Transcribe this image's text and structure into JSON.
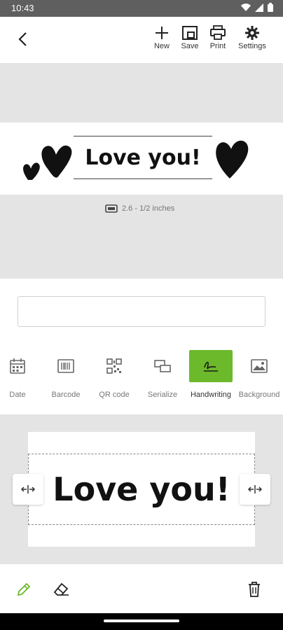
{
  "status": {
    "time": "10:43"
  },
  "toolbar": {
    "new_label": "New",
    "save_label": "Save",
    "print_label": "Print",
    "settings_label": "Settings"
  },
  "preview": {
    "label_text": "Love you!",
    "size_text": "2.6 - 1/2 inches"
  },
  "input": {
    "value": ""
  },
  "tools": [
    {
      "label": "Date",
      "icon": "calendar-icon"
    },
    {
      "label": "Barcode",
      "icon": "barcode-icon"
    },
    {
      "label": "QR code",
      "icon": "qr-code-icon"
    },
    {
      "label": "Serialize",
      "icon": "serialize-icon"
    },
    {
      "label": "Handwriting",
      "icon": "signature-icon",
      "active": true
    },
    {
      "label": "Background",
      "icon": "image-icon"
    }
  ],
  "editor": {
    "text": "Love you!"
  },
  "colors": {
    "accent": "#6cb92b",
    "gray_bg": "#e4e4e4",
    "status_bar": "#5f5f5f"
  }
}
